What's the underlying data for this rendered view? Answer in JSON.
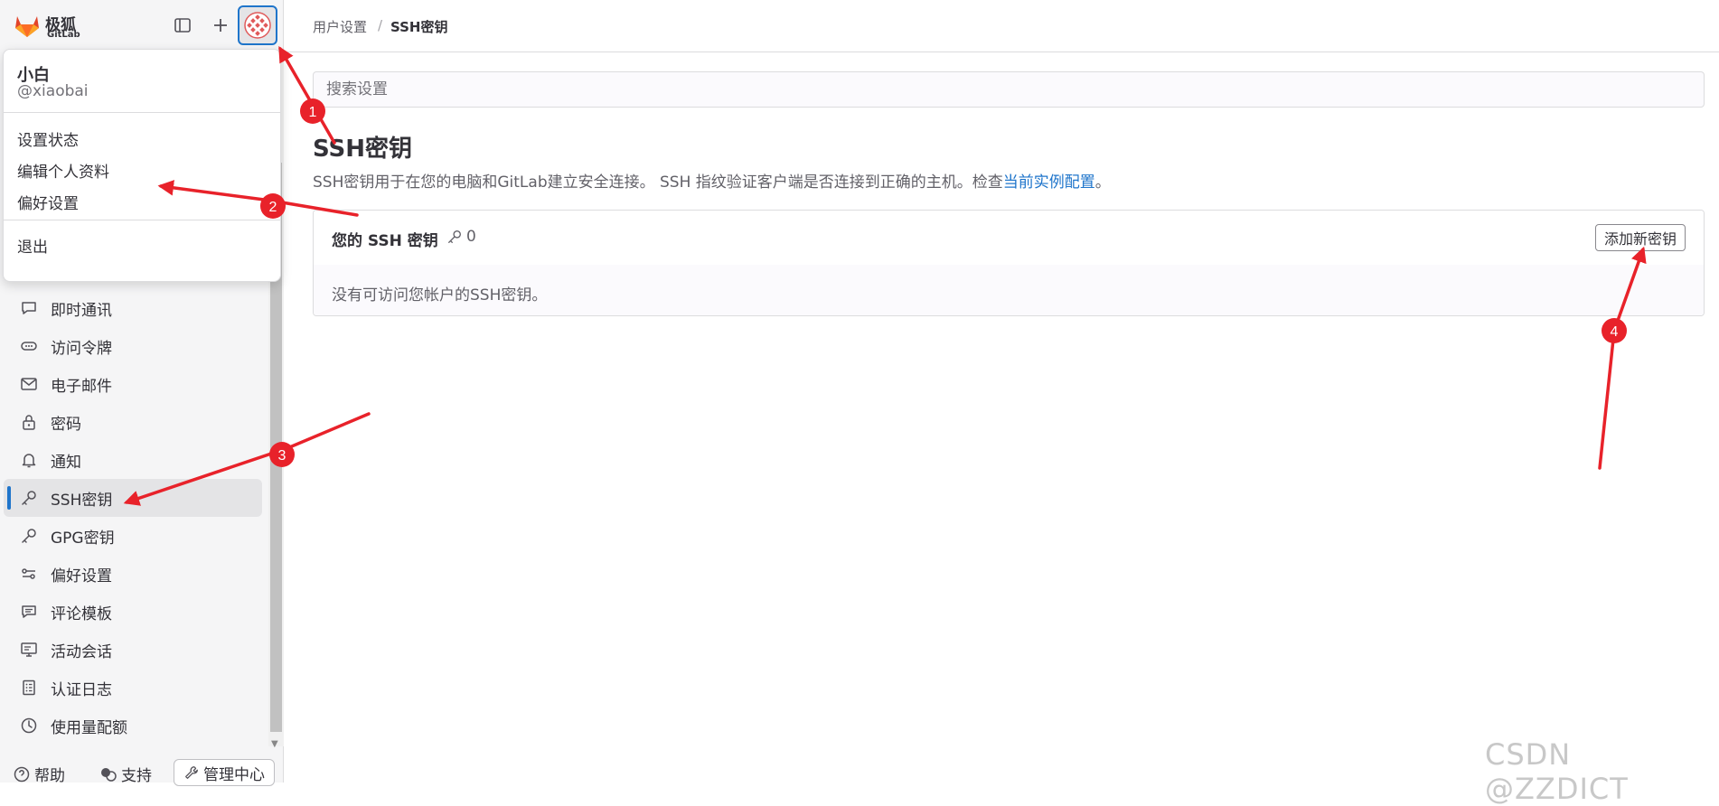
{
  "brand": {
    "name_cn": "极狐",
    "name_en": "GitLab"
  },
  "user_menu": {
    "name": "小白",
    "handle": "@xiaobai",
    "items": [
      "设置状态",
      "编辑个人资料",
      "偏好设置"
    ],
    "sign_out": "退出"
  },
  "sidebar": {
    "items": [
      {
        "label": "即时通讯",
        "icon": "chat-icon"
      },
      {
        "label": "访问令牌",
        "icon": "token-icon"
      },
      {
        "label": "电子邮件",
        "icon": "mail-icon"
      },
      {
        "label": "密码",
        "icon": "lock-icon"
      },
      {
        "label": "通知",
        "icon": "bell-icon"
      },
      {
        "label": "SSH密钥",
        "icon": "key-icon",
        "active": true
      },
      {
        "label": "GPG密钥",
        "icon": "key-icon"
      },
      {
        "label": "偏好设置",
        "icon": "preferences-icon"
      },
      {
        "label": "评论模板",
        "icon": "comment-template-icon"
      },
      {
        "label": "活动会话",
        "icon": "monitor-icon"
      },
      {
        "label": "认证日志",
        "icon": "log-icon"
      },
      {
        "label": "使用量配额",
        "icon": "quota-icon"
      }
    ],
    "bottom": {
      "help": "帮助",
      "support": "支持",
      "admin": "管理中心"
    }
  },
  "breadcrumb": {
    "parent": "用户设置",
    "separator": "/",
    "current": "SSH密钥"
  },
  "search": {
    "placeholder": "搜索设置"
  },
  "page": {
    "title": "SSH密钥",
    "description_prefix": "SSH密钥用于在您的电脑和GitLab建立安全连接。 SSH 指纹验证客户端是否连接到正确的主机。检查",
    "description_link": "当前实例配置",
    "description_suffix": "。"
  },
  "ssh_card": {
    "title": "您的 SSH 密钥",
    "count": "0",
    "add_button": "添加新密钥",
    "empty_text": "没有可访问您帐户的SSH密钥。"
  },
  "annotations": {
    "n1": "1",
    "n2": "2",
    "n3": "3",
    "n4": "4",
    "arrow_color": "#e8222a"
  },
  "watermark": "CSDN @ZZDICT",
  "colors": {
    "accent": "#1f75cb",
    "logo_orange": "#e24329"
  }
}
